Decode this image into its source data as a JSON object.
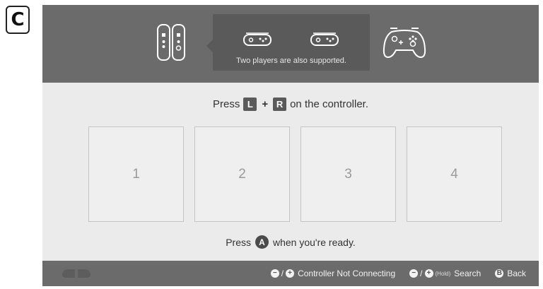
{
  "badge": {
    "letter": "C"
  },
  "header": {
    "popup_text": "Two players are also supported.",
    "icons": [
      "joycon-pair-icon",
      "sideways-joycon-icon",
      "pro-controller-icon"
    ]
  },
  "instruction": {
    "prefix": "Press",
    "key_l": "L",
    "plus": "+",
    "key_r": "R",
    "suffix": "on the controller."
  },
  "slots": [
    "1",
    "2",
    "3",
    "4"
  ],
  "ready": {
    "prefix": "Press",
    "button": "A",
    "suffix": "when you're ready."
  },
  "bottom_bar": {
    "minus": "−",
    "plus": "+",
    "slash": "/",
    "not_connecting": "Controller Not Connecting",
    "hold": "(Hold)",
    "search": "Search",
    "back_button": "B",
    "back": "Back"
  },
  "colors": {
    "top_band": "#6b6b6b",
    "background": "#ebebeb",
    "popup": "#5a5a5a",
    "bottom_bar": "#6b6b6b"
  }
}
